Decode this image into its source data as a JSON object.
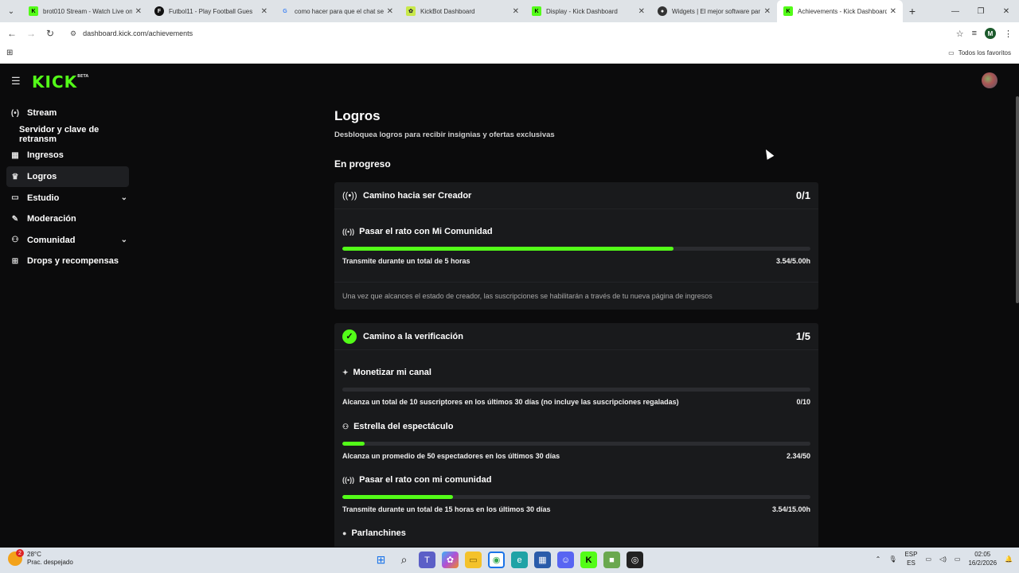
{
  "browser": {
    "tabs": [
      {
        "title": "brot010 Stream - Watch Live on",
        "favicon_color": "#53fc18",
        "active": false
      },
      {
        "title": "Futbol11 - Play Football Gues",
        "favicon_color": "#111111",
        "active": false
      },
      {
        "title": "como hacer para que el chat se",
        "favicon_color": "#4285f4",
        "active": false
      },
      {
        "title": "KickBot Dashboard",
        "favicon_color": "#c8e84a",
        "active": false
      },
      {
        "title": "Display - Kick Dashboard",
        "favicon_color": "#53fc18",
        "active": false
      },
      {
        "title": "Widgets | El mejor software par",
        "favicon_color": "#333333",
        "active": false
      },
      {
        "title": "Achievements - Kick Dashboard",
        "favicon_color": "#53fc18",
        "active": true
      }
    ],
    "url": "dashboard.kick.com/achievements",
    "bookmarks_all": "Todos los favoritos",
    "profile_initial": "M"
  },
  "app": {
    "logo": "KICK",
    "logo_tag": "BETA",
    "accent": "#53fc18"
  },
  "sidebar": {
    "items": [
      {
        "label": "Stream",
        "icon": "broadcast-icon",
        "glyph": "(•)",
        "sub": false,
        "active": false,
        "chevron": false
      },
      {
        "label": "Servidor y clave de retransm",
        "icon": "",
        "glyph": "",
        "sub": true,
        "active": false,
        "chevron": false
      },
      {
        "label": "Ingresos",
        "icon": "revenue-icon",
        "glyph": "▦",
        "sub": false,
        "active": false,
        "chevron": false
      },
      {
        "label": "Logros",
        "icon": "trophy-icon",
        "glyph": "🏆",
        "sub": false,
        "active": true,
        "chevron": false
      },
      {
        "label": "Estudio",
        "icon": "studio-icon",
        "glyph": "▭",
        "sub": false,
        "active": false,
        "chevron": true
      },
      {
        "label": "Moderación",
        "icon": "wrench-icon",
        "glyph": "🔧",
        "sub": false,
        "active": false,
        "chevron": false
      },
      {
        "label": "Comunidad",
        "icon": "community-icon",
        "glyph": "👥",
        "sub": false,
        "active": false,
        "chevron": true
      },
      {
        "label": "Drops y recompensas",
        "icon": "gift-icon",
        "glyph": "⊞",
        "sub": false,
        "active": false,
        "chevron": false
      }
    ]
  },
  "main": {
    "title": "Logros",
    "subtitle": "Desbloquea logros para recibir insignias y ofertas exclusivas",
    "section": "En progreso",
    "cards": [
      {
        "title": "Camino hacia ser Creador",
        "count": "0/1",
        "tasks": [
          {
            "title": "Pasar el rato con Mi Comunidad",
            "desc": "Transmite durante un total de 5 horas",
            "value": "3.54/5.00h",
            "progress": 0.708
          }
        ],
        "note": "Una vez que alcances el estado de creador, las suscripciones se habilitarán a través de tu nueva página de ingresos"
      },
      {
        "title": "Camino a la verificación",
        "count": "1/5",
        "tasks": [
          {
            "title": "Monetizar mi canal",
            "desc": "Alcanza un total de 10 suscriptores en los últimos 30 días (no incluye las suscripciones regaladas)",
            "value": "0/10",
            "progress": 0.0
          },
          {
            "title": "Estrella del espectáculo",
            "desc": "Alcanza un promedio de 50 espectadores en los últimos 30 días",
            "value": "2.34/50",
            "progress": 0.047
          },
          {
            "title": "Pasar el rato con mi comunidad",
            "desc": "Transmite durante un total de 15 horas en los últimos 30 días",
            "value": "3.54/15.00h",
            "progress": 0.236
          },
          {
            "title": "Parlanchines",
            "desc": "",
            "value": "",
            "progress": 0.0
          }
        ]
      }
    ]
  },
  "taskbar": {
    "weather_badge": "2",
    "temp": "28°C",
    "weather_desc": "Prac. despejado",
    "lang_top": "ESP",
    "lang_bottom": "ES",
    "time": "02:05",
    "date": "16/2/2026"
  }
}
